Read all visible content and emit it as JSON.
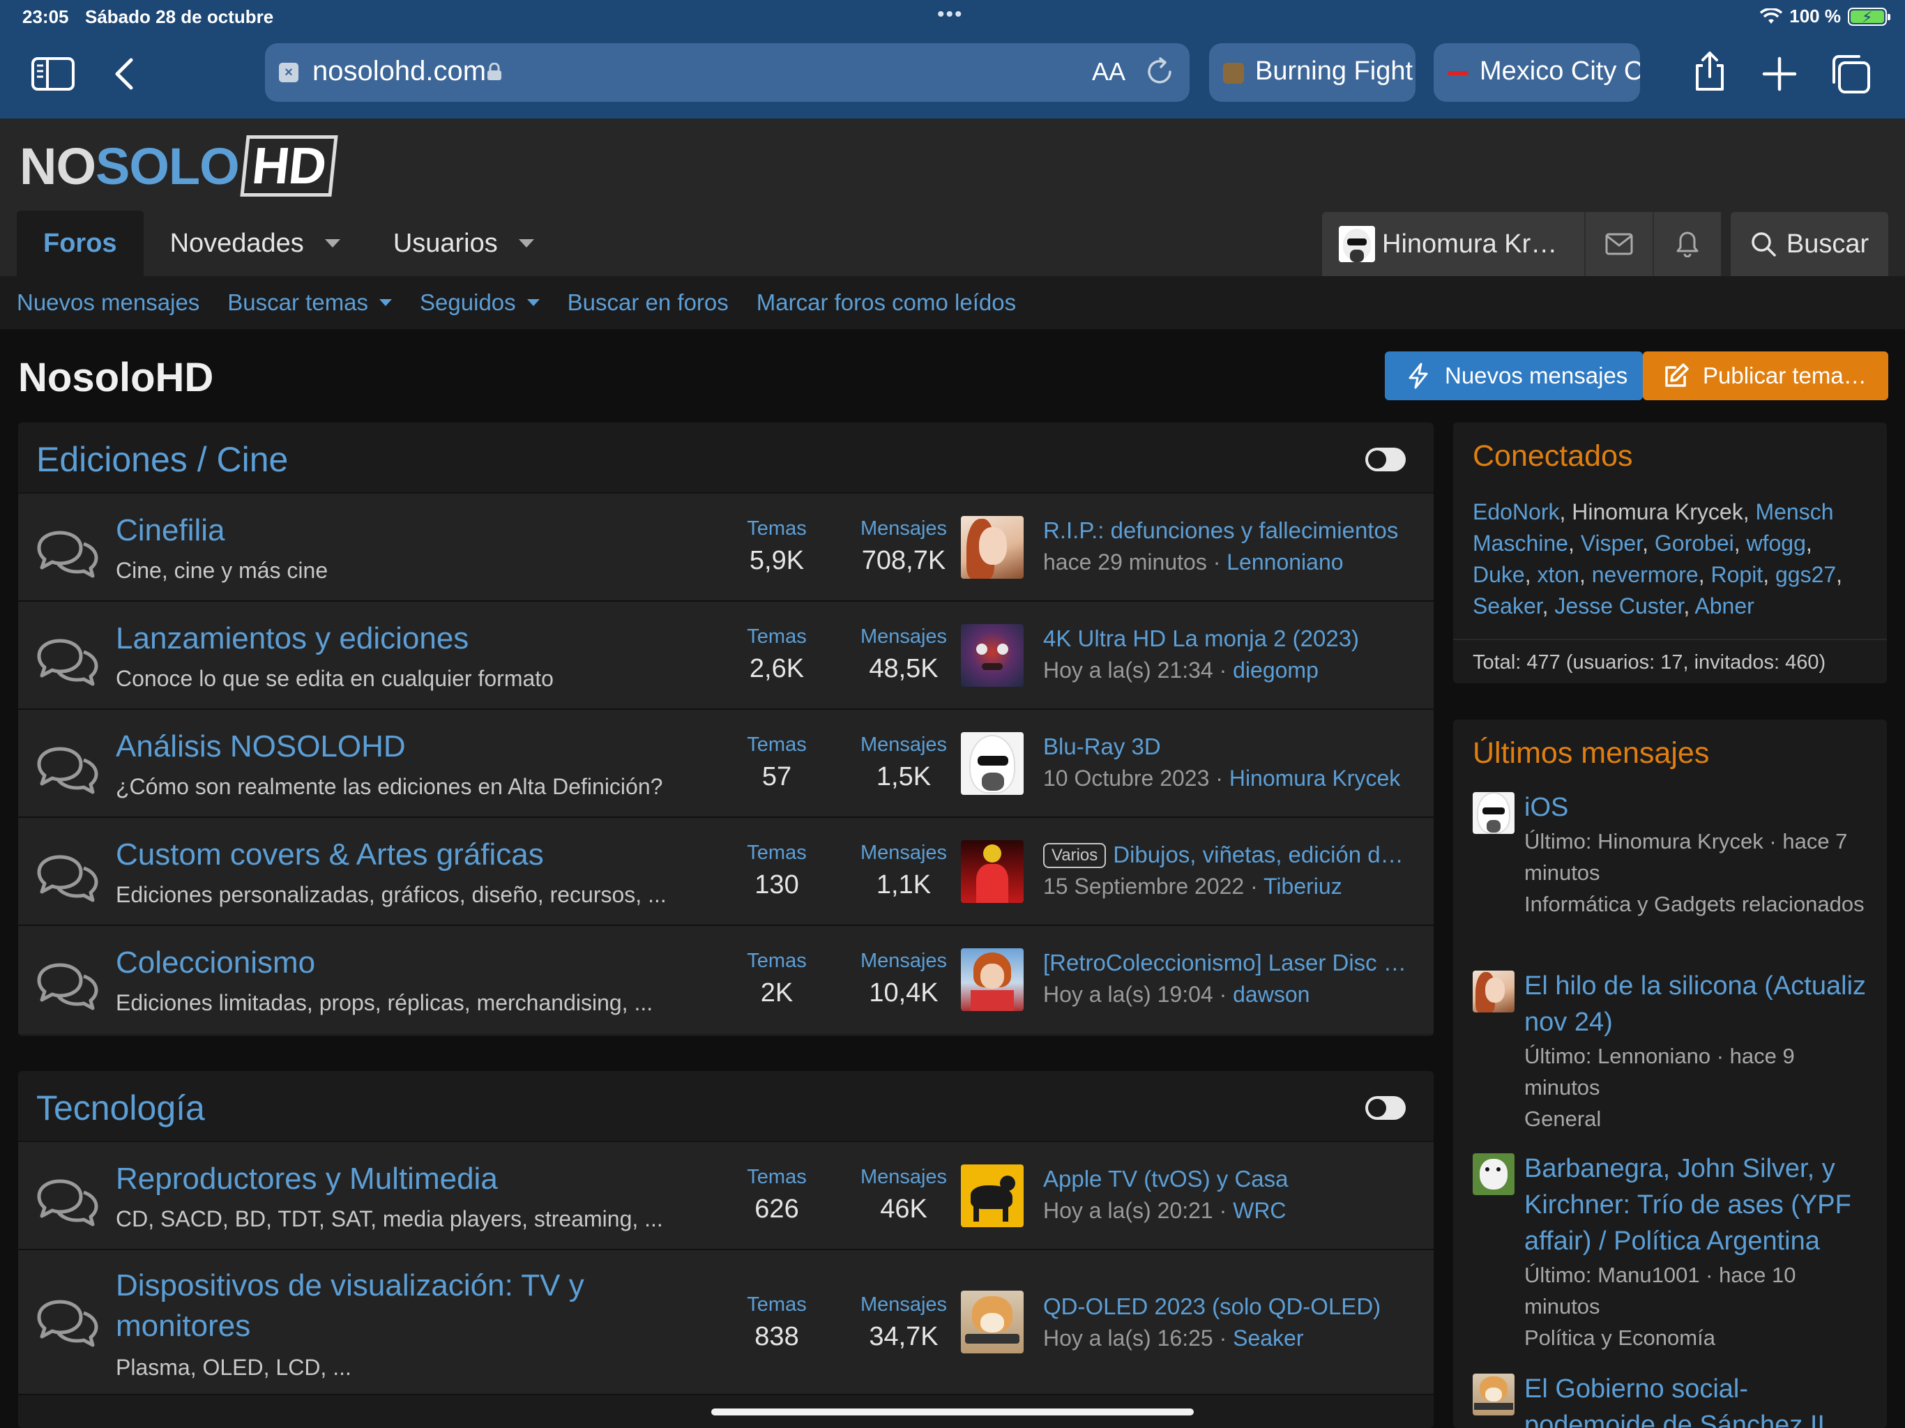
{
  "status_bar": {
    "time": "23:05",
    "date": "Sábado 28 de octubre",
    "battery": "100 %"
  },
  "browser": {
    "url": "nosolohd.com",
    "text_size_label": "AA",
    "tabs": [
      {
        "title": "Burning Fight"
      },
      {
        "title": "Mexico City C"
      }
    ]
  },
  "site": {
    "logo": {
      "part1": "NO",
      "part2": "SOLO",
      "part3": "HD"
    },
    "nav": {
      "forums": "Foros",
      "whats_new": "Novedades",
      "members": "Usuarios"
    },
    "user": {
      "name": "Hinomura Kr…",
      "search": "Buscar"
    },
    "sub_nav": {
      "new_posts": "Nuevos mensajes",
      "search_threads": "Buscar temas",
      "watched": "Seguidos",
      "search_forums": "Buscar en foros",
      "mark_read": "Marcar foros como leídos"
    },
    "page_title": "NosoloHD",
    "buttons": {
      "new_posts": "Nuevos mensajes",
      "post_thread": "Publicar tema…"
    }
  },
  "stat_labels": {
    "threads": "Temas",
    "messages": "Mensajes"
  },
  "categories": [
    {
      "title": "Ediciones / Cine",
      "forums": [
        {
          "title": "Cinefilia",
          "desc": "Cine, cine y más cine",
          "threads": "5,9K",
          "messages": "708,7K",
          "last_title": "R.I.P.: defunciones y fallecimientos",
          "last_date": "hace 29 minutos",
          "last_user": "Lennoniano"
        },
        {
          "title": "Lanzamientos y ediciones",
          "desc": "Conoce lo que se edita en cualquier formato",
          "threads": "2,6K",
          "messages": "48,5K",
          "last_title": "4K Ultra HD La monja 2 (2023)",
          "last_date": "Hoy a la(s) 21:34",
          "last_user": "diegomp"
        },
        {
          "title": "Análisis NOSOLOHD",
          "desc": "¿Cómo son realmente las ediciones en Alta Definición?",
          "threads": "57",
          "messages": "1,5K",
          "last_title": "Blu-Ray 3D",
          "last_date": "10 Octubre 2023",
          "last_user": "Hinomura Krycek"
        },
        {
          "title": "Custom covers & Artes gráficas",
          "desc": "Ediciones personalizadas, gráficos, diseño, recursos, ...",
          "threads": "130",
          "messages": "1,1K",
          "last_label": "Varios",
          "last_title": "Dibujos, viñetas, edición d…",
          "last_date": "15 Septiembre 2022",
          "last_user": "Tiberiuz"
        },
        {
          "title": "Coleccionismo",
          "desc": "Ediciones limitadas, props, réplicas, merchandising, ...",
          "threads": "2K",
          "messages": "10,4K",
          "last_title": "[RetroColeccionismo] Laser Disc (…",
          "last_date": "Hoy a la(s) 19:04",
          "last_user": "dawson"
        }
      ]
    },
    {
      "title": "Tecnología",
      "forums": [
        {
          "title": "Reproductores y Multimedia",
          "desc": "CD, SACD, BD, TDT, SAT, media players, streaming, ...",
          "threads": "626",
          "messages": "46K",
          "last_title": "Apple TV (tvOS) y Casa",
          "last_date": "Hoy a la(s) 20:21",
          "last_user": "WRC"
        },
        {
          "title": "Dispositivos de visualización: TV y monitores",
          "desc": "Plasma, OLED, LCD, ...",
          "threads": "838",
          "messages": "34,7K",
          "last_title": "QD-OLED 2023 (solo QD-OLED)",
          "last_date": "Hoy a la(s) 16:25",
          "last_user": "Seaker"
        }
      ]
    }
  ],
  "sidebar": {
    "online": {
      "title": "Conectados",
      "users": [
        "EdoNork",
        "Hinomura Krycek",
        "Mensch Maschine",
        "Visper",
        "Gorobei",
        "wfogg",
        "Duke",
        "xton",
        "nevermore",
        "Ropit",
        "ggs27",
        "Seaker",
        "Jesse Custer",
        "Abner"
      ],
      "total": "Total: 477 (usuarios: 17, invitados: 460)"
    },
    "latest": {
      "title": "Últimos mensajes",
      "posts": [
        {
          "title": "iOS",
          "meta": "Último: Hinomura Krycek · hace 7 minutos",
          "forum": "Informática y Gadgets relacionados"
        },
        {
          "title": "El hilo de la silicona (Actualiz nov 24)",
          "meta": "Último: Lennoniano · hace 9 minutos",
          "forum": "General"
        },
        {
          "title": "Barbanegra, John Silver, y Kirchner: Trío de ases (YPF affair) / Política Argentina",
          "meta": "Último: Manu1001 · hace 10 minutos",
          "forum": "Política y Economía"
        },
        {
          "title": "El Gobierno social-podemoide de Sánchez II"
        }
      ]
    }
  },
  "colors": {
    "accent_blue": "#5c9fd6",
    "accent_orange": "#e07f10",
    "safari_bar": "#1d4775"
  }
}
